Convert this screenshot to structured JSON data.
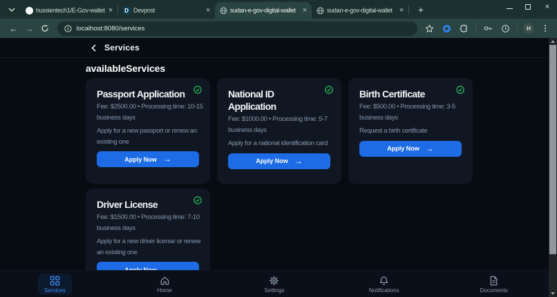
{
  "browser": {
    "tabs": [
      {
        "title": "hussientech1/E-Gov-wallet",
        "icon": "github"
      },
      {
        "title": "Devpost",
        "icon": "devpost"
      },
      {
        "title": "sudan-e-gov-digital-wallet",
        "icon": "globe"
      },
      {
        "title": "sudan-e-gov-digital-wallet",
        "icon": "globe"
      }
    ],
    "devpost_letter": "D",
    "close_glyph": "×",
    "new_tab_glyph": "+",
    "url": "localhost:8080/services",
    "avatar_letter": "H"
  },
  "page": {
    "header": {
      "title": "Services"
    },
    "heading": "availableServices",
    "services": [
      {
        "title": "Passport Application",
        "fee": "Fee: $2500.00 • Processing time: 10-15 business days",
        "description": "Apply for a new passport or renew an existing one",
        "cta": "Apply Now"
      },
      {
        "title": "National ID Application",
        "fee": "Fee: $1000.00 • Processing time: 5-7 business days",
        "description": "Apply for a national identification card",
        "cta": "Apply Now"
      },
      {
        "title": "Birth Certificate",
        "fee": "Fee: $500.00 • Processing time: 3-5 business days",
        "description": "Request a birth certificate",
        "cta": "Apply Now"
      },
      {
        "title": "Driver License",
        "fee": "Fee: $1500.00 • Processing time: 7-10 business days",
        "description": "Apply for a new driver license or renew an existing one",
        "cta": "Apply Now"
      }
    ],
    "nav": [
      {
        "label": "Services"
      },
      {
        "label": "Home"
      },
      {
        "label": "Settings"
      },
      {
        "label": "Notifications"
      },
      {
        "label": "Documents"
      }
    ],
    "colors": {
      "accent": "#1d6ce5",
      "success": "#22c55e"
    }
  }
}
